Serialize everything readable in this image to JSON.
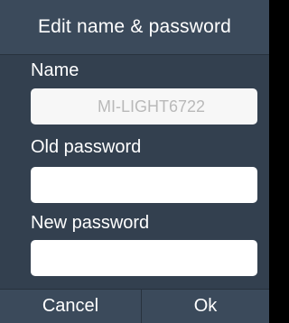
{
  "dialog": {
    "title": "Edit name & password",
    "fields": {
      "name": {
        "label": "Name",
        "value": "MI-LIGHT6722"
      },
      "old_password": {
        "label": "Old password",
        "value": ""
      },
      "new_password": {
        "label": "New password",
        "value": ""
      }
    },
    "buttons": {
      "cancel": "Cancel",
      "ok": "Ok"
    }
  },
  "colors": {
    "dialog_background": "#33404f",
    "header_background": "#3b4a5b",
    "divider": "#28323e",
    "text": "#ffffff",
    "field_background": "#ffffff",
    "name_text": "#b9b9b9"
  }
}
